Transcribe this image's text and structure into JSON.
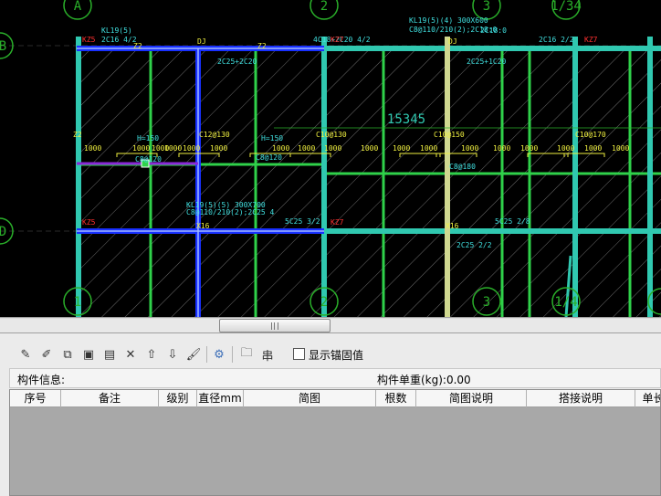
{
  "cad": {
    "axes_top": [
      "A",
      "2",
      "3",
      "1/34"
    ],
    "axes_bottom": [
      "1",
      "2",
      "3",
      "1/4"
    ],
    "axes_left": [
      "B",
      "D"
    ],
    "dim_label": "15345",
    "beam_labels": [
      "KL19(5)",
      "2C16 4/2",
      "DJ",
      "2C25+2C20",
      "4C18+2C20 4/2",
      "KL19(5)(4) 300X600",
      "C8@110/210(2);2C18:0",
      "DJ",
      "2C25+1C20",
      "2C16 2/2",
      "C12@130",
      "C10@130",
      "C10@150",
      "C10@170",
      "C8@120",
      "C8@120",
      "KL19(5)(5) 300X700",
      "C8@110/210(2);2C25 4",
      "5C25 3/2",
      "5C25 2/8",
      "2C25 2/2",
      "2C18:0",
      "C8@180",
      "1000",
      "1000",
      "1000",
      "1000",
      "1000",
      "1000",
      "1000",
      "1000",
      "1000",
      "1000",
      "1000",
      "1000",
      "1000",
      "1000",
      "1000",
      "1000",
      "1000",
      "1000",
      "H=150",
      "H=150",
      "Z2",
      "Z2",
      "Z2",
      "X16",
      "X16",
      "KZ5",
      "KZ5",
      "KZ7",
      "KZ7",
      "KZ7"
    ]
  },
  "toolbar": {
    "icons": [
      "pen-icon",
      "pen-alt-icon",
      "copy-icon",
      "paste-icon",
      "paste-alt-icon",
      "delete-icon",
      "move-up-icon",
      "move-down-icon",
      "brush-icon",
      "settings-icon",
      "folder-icon",
      "table-icon"
    ],
    "show_anchor_label": "显示锚固值",
    "show_anchor_checked": false
  },
  "info": {
    "component_info_label": "构件信息:",
    "component_weight_label": "构件单重(kg):0.00"
  },
  "grid": {
    "columns": [
      "序号",
      "备注",
      "级别",
      "直径mm",
      "简图",
      "根数",
      "简图说明",
      "搭接说明",
      "单长"
    ]
  },
  "colors": {
    "background": "#000000",
    "beam_green": "#2fd14a",
    "beam_teal": "#30c8b0",
    "beam_blue": "#1830ff",
    "beam_purple": "#8a28d8",
    "axis_green": "#2ab02a",
    "text_yellow": "#f0f040",
    "text_cyan": "#40e0e0",
    "text_red": "#ff3030"
  }
}
